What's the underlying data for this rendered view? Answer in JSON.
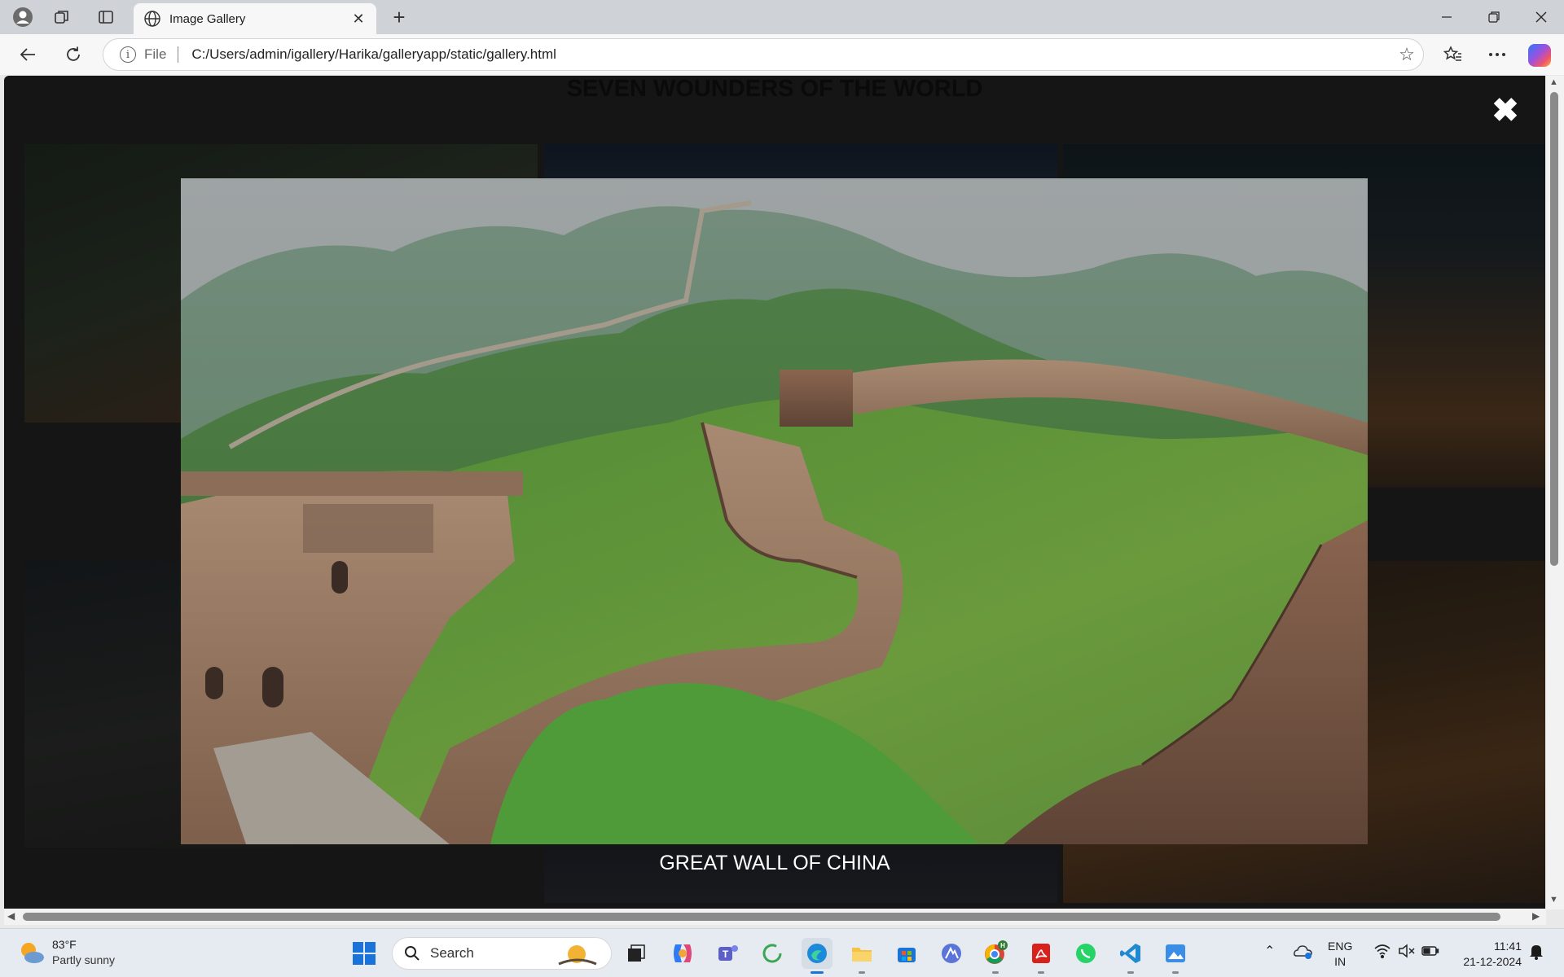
{
  "browser": {
    "tab_title": "Image Gallery",
    "tab_close": "✕",
    "new_tab": "+",
    "address_scheme": "File",
    "address_url": "C:/Users/admin/igallery/Harika/galleryapp/static/gallery.html",
    "info_glyph": "i"
  },
  "page": {
    "title": "SEVEN WOUNDERS OF THE WORLD",
    "close_glyph": "✖",
    "caption": "GREAT WALL OF CHINA"
  },
  "taskbar": {
    "weather_temp": "83°F",
    "weather_condition": "Partly sunny",
    "search_label": "Search",
    "language_top": "ENG",
    "language_bottom": "IN",
    "time": "11:41",
    "date": "21-12-2024"
  },
  "icons": [
    "profile-icon",
    "workspaces-icon",
    "tab-actions-icon",
    "globe-icon",
    "back-icon",
    "refresh-icon",
    "info-icon",
    "star-icon",
    "favorites-icon",
    "more-icon",
    "copilot-icon",
    "close-icon",
    "windows-start-icon",
    "search-icon",
    "task-view-icon",
    "copilot-app-icon",
    "teams-icon",
    "edge-icon",
    "file-explorer-icon",
    "store-icon",
    "chrome-icon",
    "acrobat-icon",
    "whatsapp-icon",
    "vscode-icon",
    "paint-icon",
    "wifi-icon",
    "volume-mute-icon",
    "battery-icon",
    "bell-icon"
  ]
}
